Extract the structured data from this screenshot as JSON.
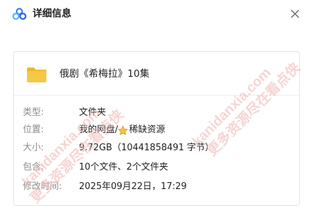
{
  "dialog": {
    "title": "详细信息",
    "close_icon": "close-icon",
    "logo_icon": "cloud-logo-icon"
  },
  "file": {
    "icon": "folder-icon",
    "name": "俄剧《希梅拉》10集"
  },
  "details": {
    "type": {
      "label": "类型:",
      "value": "文件夹"
    },
    "location": {
      "label": "位置:",
      "path_prefix": "我的网盘/",
      "star_icon": "star-icon",
      "path_suffix": "稀缺资源"
    },
    "size": {
      "label": "大小:",
      "value": "9.72GB（10441858491 字节）"
    },
    "contains": {
      "label": "包含:",
      "value": "10个文件、2个文件夹"
    },
    "modified": {
      "label": "修改时间:",
      "value": "2025年09月22日，17:29"
    }
  },
  "watermark": {
    "text_a": "kanidanxia.com",
    "text_b": "更多资源尽在看点侠",
    "color": "#f2b8b8"
  },
  "colors": {
    "label": "#8c8c8c",
    "value": "#1f1f1f",
    "folder": "#f7c844",
    "folder_dark": "#f0b429",
    "star": "#f6c343"
  }
}
